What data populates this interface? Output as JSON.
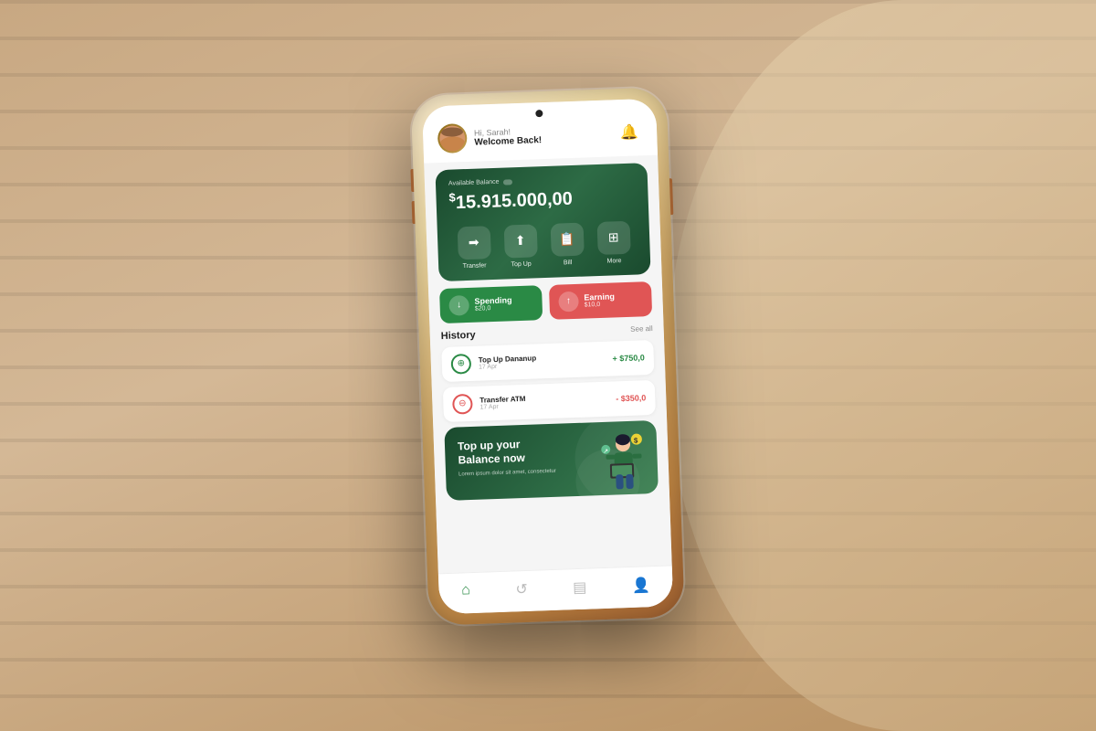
{
  "background": {
    "color": "#c8a882"
  },
  "header": {
    "greeting": "Hi, Sarah!",
    "username": "Welcome Back!",
    "notification_icon": "🔔"
  },
  "balance": {
    "label": "Available Balance",
    "amount": "$15.915.000,00",
    "currency_symbol": "$",
    "amount_value": "15.915.000,00"
  },
  "action_buttons": [
    {
      "label": "Transfer",
      "icon": "➡"
    },
    {
      "label": "Top Up",
      "icon": "📋"
    },
    {
      "label": "Bill",
      "icon": "💳"
    },
    {
      "label": "More",
      "icon": "⊞"
    }
  ],
  "stats": {
    "spending": {
      "label": "Spending",
      "amount": "$20,0",
      "icon": "↓"
    },
    "earning": {
      "label": "Earning",
      "amount": "$10,0",
      "icon": "↑"
    }
  },
  "history": {
    "title": "History",
    "see_all": "See all",
    "items": [
      {
        "name": "Top Up Dananup",
        "date": "17 Apr",
        "amount": "+ $750,0",
        "type": "positive"
      },
      {
        "name": "Transfer ATM",
        "date": "17 Apr",
        "amount": "- $350,0",
        "type": "negative"
      }
    ]
  },
  "promo": {
    "title": "Top up your\nBalance now",
    "subtitle": "Lorem ipsum dolor sit amet, consectetur",
    "cta": "Top UP your Balance now"
  },
  "bottom_nav": [
    {
      "icon": "⌂",
      "label": "home",
      "active": true
    },
    {
      "icon": "↺",
      "label": "history",
      "active": false
    },
    {
      "icon": "📄",
      "label": "cards",
      "active": false
    },
    {
      "icon": "👤",
      "label": "profile",
      "active": false
    }
  ]
}
